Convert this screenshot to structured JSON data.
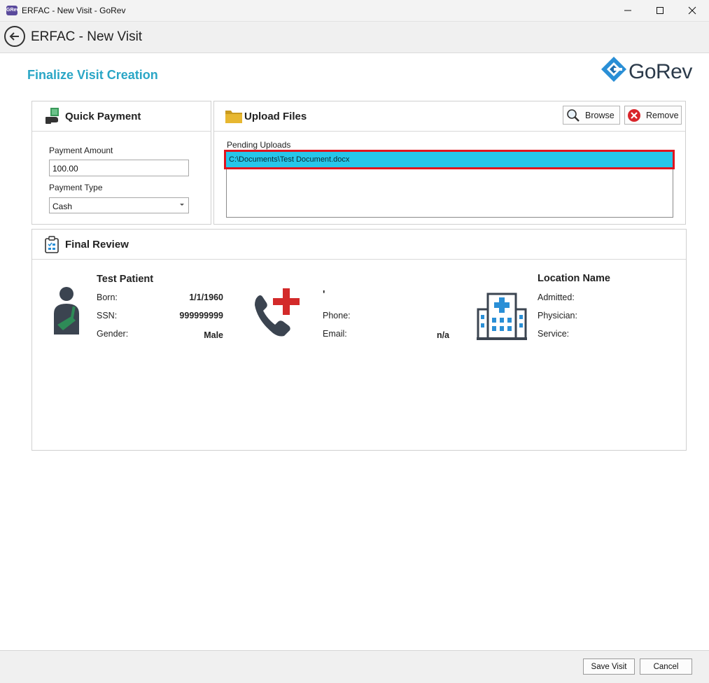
{
  "window": {
    "title": "ERFAC - New Visit - GoRev",
    "app_icon_text": "GRev",
    "minimize_icon": "minimize-icon",
    "maximize_icon": "maximize-icon",
    "close_icon": "close-icon"
  },
  "header": {
    "title": "ERFAC - New Visit",
    "back_icon": "back-arrow-icon"
  },
  "page": {
    "title": "Finalize Visit Creation",
    "logo_text": "GoRev"
  },
  "quick_payment": {
    "title": "Quick Payment",
    "icon": "payment-icon",
    "amount_label": "Payment Amount",
    "amount_value": "100.00",
    "type_label": "Payment Type",
    "type_value": "Cash"
  },
  "upload_files": {
    "title": "Upload Files",
    "icon": "folder-icon",
    "browse_label": "Browse",
    "remove_label": "Remove",
    "pending_label": "Pending Uploads",
    "pending_items": [
      "C:\\Documents\\Test Document.docx"
    ]
  },
  "final_review": {
    "title": "Final Review",
    "icon": "clipboard-icon",
    "patient": {
      "name": "Test Patient",
      "born_label": "Born:",
      "born_value": "1/1/1960",
      "ssn_label": "SSN:",
      "ssn_value": "999999999",
      "gender_label": "Gender:",
      "gender_value": "Male"
    },
    "contact": {
      "name": "'",
      "phone_label": "Phone:",
      "phone_value": "",
      "email_label": "Email:",
      "email_value": "n/a"
    },
    "location": {
      "name": "Location Name",
      "admitted_label": "Admitted:",
      "physician_label": "Physician:",
      "service_label": "Service:"
    }
  },
  "footer": {
    "save_label": "Save Visit",
    "cancel_label": "Cancel"
  },
  "colors": {
    "accent": "#2aa6c6",
    "selection": "#26c6ea",
    "highlight_border": "#e0141e",
    "remove_icon": "#d9252b",
    "medical_cross": "#d32a2a",
    "patient_sling": "#2e8b57"
  }
}
